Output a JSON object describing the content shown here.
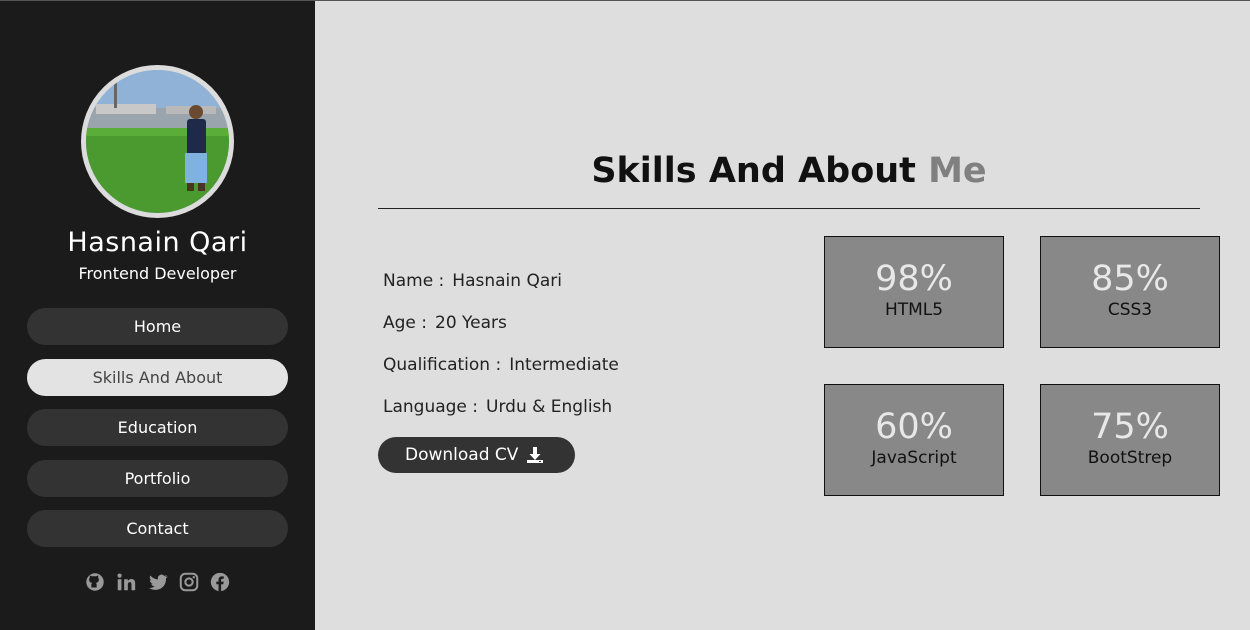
{
  "profile": {
    "name": "Hasnain Qari",
    "role": "Frontend Developer"
  },
  "nav": {
    "items": [
      {
        "label": "Home"
      },
      {
        "label": "Skills And About"
      },
      {
        "label": "Education"
      },
      {
        "label": "Portfolio"
      },
      {
        "label": "Contact"
      }
    ],
    "active": "Skills And About"
  },
  "social": [
    "github-icon",
    "linkedin-icon",
    "twitter-icon",
    "instagram-icon",
    "facebook-icon"
  ],
  "header": {
    "title_main": "Skills And About",
    "title_accent": "Me"
  },
  "info": [
    {
      "key": "Name :",
      "value": "Hasnain Qari"
    },
    {
      "key": "Age :",
      "value": "20 Years"
    },
    {
      "key": "Qualification :",
      "value": "Intermediate"
    },
    {
      "key": "Language :",
      "value": "Urdu & English"
    }
  ],
  "download": {
    "label": "Download CV"
  },
  "skills": [
    {
      "percent": "98%",
      "name": "HTML5"
    },
    {
      "percent": "85%",
      "name": "CSS3"
    },
    {
      "percent": "60%",
      "name": "JavaScript"
    },
    {
      "percent": "75%",
      "name": "BootStrep"
    }
  ],
  "colors": {
    "sidebar_bg": "#1b1b1b",
    "page_bg": "#dedede",
    "button_bg": "#333333",
    "active_nav_bg": "#e3e3e3",
    "skill_card_bg": "#888888",
    "accent_text": "#808080"
  }
}
